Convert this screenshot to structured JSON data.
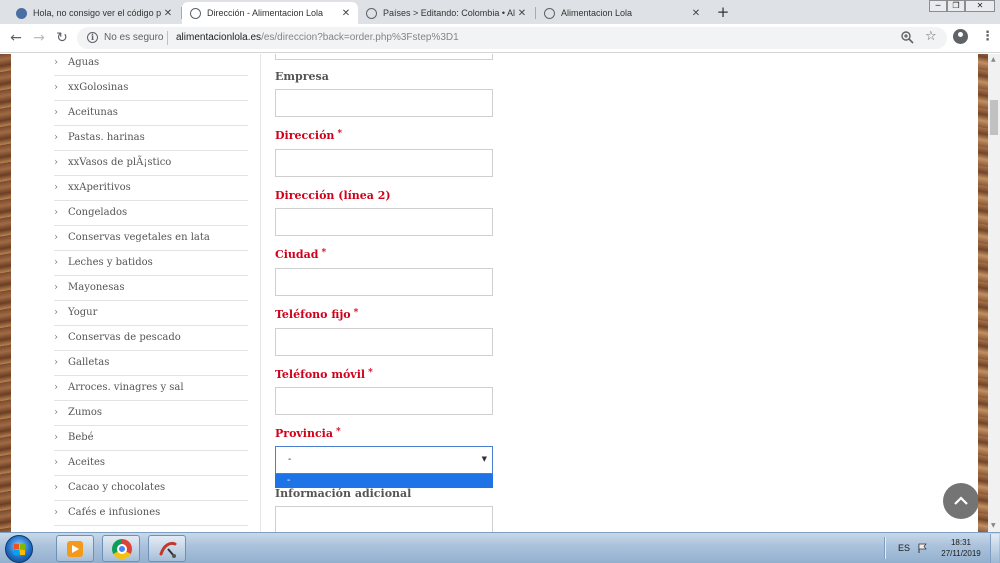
{
  "browser": {
    "tabs": [
      {
        "title": "Hola, no consigo ver el código p",
        "favicon_color": "#4a6fa5",
        "active": false
      },
      {
        "title": "Dirección - Alimentacion Lola",
        "favicon_color": "#5f6368",
        "active": true
      },
      {
        "title": "Países > Editando: Colombia • Al",
        "favicon_color": "#5f6368",
        "active": false
      },
      {
        "title": "Alimentacion Lola",
        "favicon_color": "#5f6368",
        "active": false
      }
    ],
    "new_tab_label": "+",
    "window_controls": {
      "minimize": "─",
      "maximize": "❐",
      "close": "✕"
    },
    "not_secure_label": "No es seguro",
    "url_host": "alimentacionlola.es",
    "url_path": "/es/direccion?back=order.php%3Fstep%3D1"
  },
  "sidebar": {
    "categories": [
      "Aguas",
      "xxGolosinas",
      "Aceitunas",
      "Pastas. harinas",
      "xxVasos de plÃ¡stico",
      "xxAperitivos",
      "Congelados",
      "Conservas vegetales en lata",
      "Leches y batidos",
      "Mayonesas",
      "Yogur",
      "Conservas de pescado",
      "Galletas",
      "Arroces. vinagres y sal",
      "Zumos",
      "Bebé",
      "Aceites",
      "Cacao y chocolates",
      "Cafés e infusiones"
    ]
  },
  "form": {
    "empresa_label": "Empresa",
    "direccion_label": "Dirección",
    "direccion2_label": "Dirección (línea 2)",
    "ciudad_label": "Ciudad",
    "telefono_fijo_label": "Teléfono fijo",
    "telefono_movil_label": "Teléfono móvil",
    "provincia_label": "Provincia",
    "provincia_value": "-",
    "provincia_option": "-",
    "info_adicional_label": "Información adicional",
    "required_mark": "*"
  },
  "taskbar": {
    "language": "ES",
    "time": "18:31",
    "date": "27/11/2019"
  },
  "colors": {
    "required": "#d0021b",
    "select_highlight": "#1e73e6",
    "active_tab": "#ffffff",
    "tabstrip": "#dee1e6"
  }
}
